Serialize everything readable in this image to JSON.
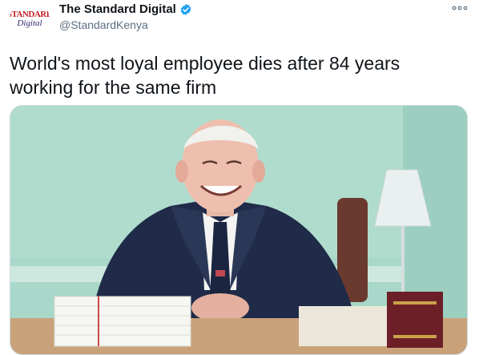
{
  "account": {
    "display_name": "The Standard Digital",
    "handle": "@StandardKenya",
    "avatar_logo_top": "STANDARD",
    "avatar_logo_bottom": "Digital",
    "verified_icon": "verified-badge-icon"
  },
  "tweet": {
    "text": "World's most loyal employee dies after 84 years working for the same firm"
  },
  "media": {
    "alt": "photo of an elderly smiling man in a dark suit and striped tie seated at a desk with stacked papers and books"
  },
  "colors": {
    "verified": "#1da1f2",
    "handle": "#5b7083",
    "wall": "#a9d7c9"
  },
  "icons": {
    "more": "more-options-icon"
  }
}
